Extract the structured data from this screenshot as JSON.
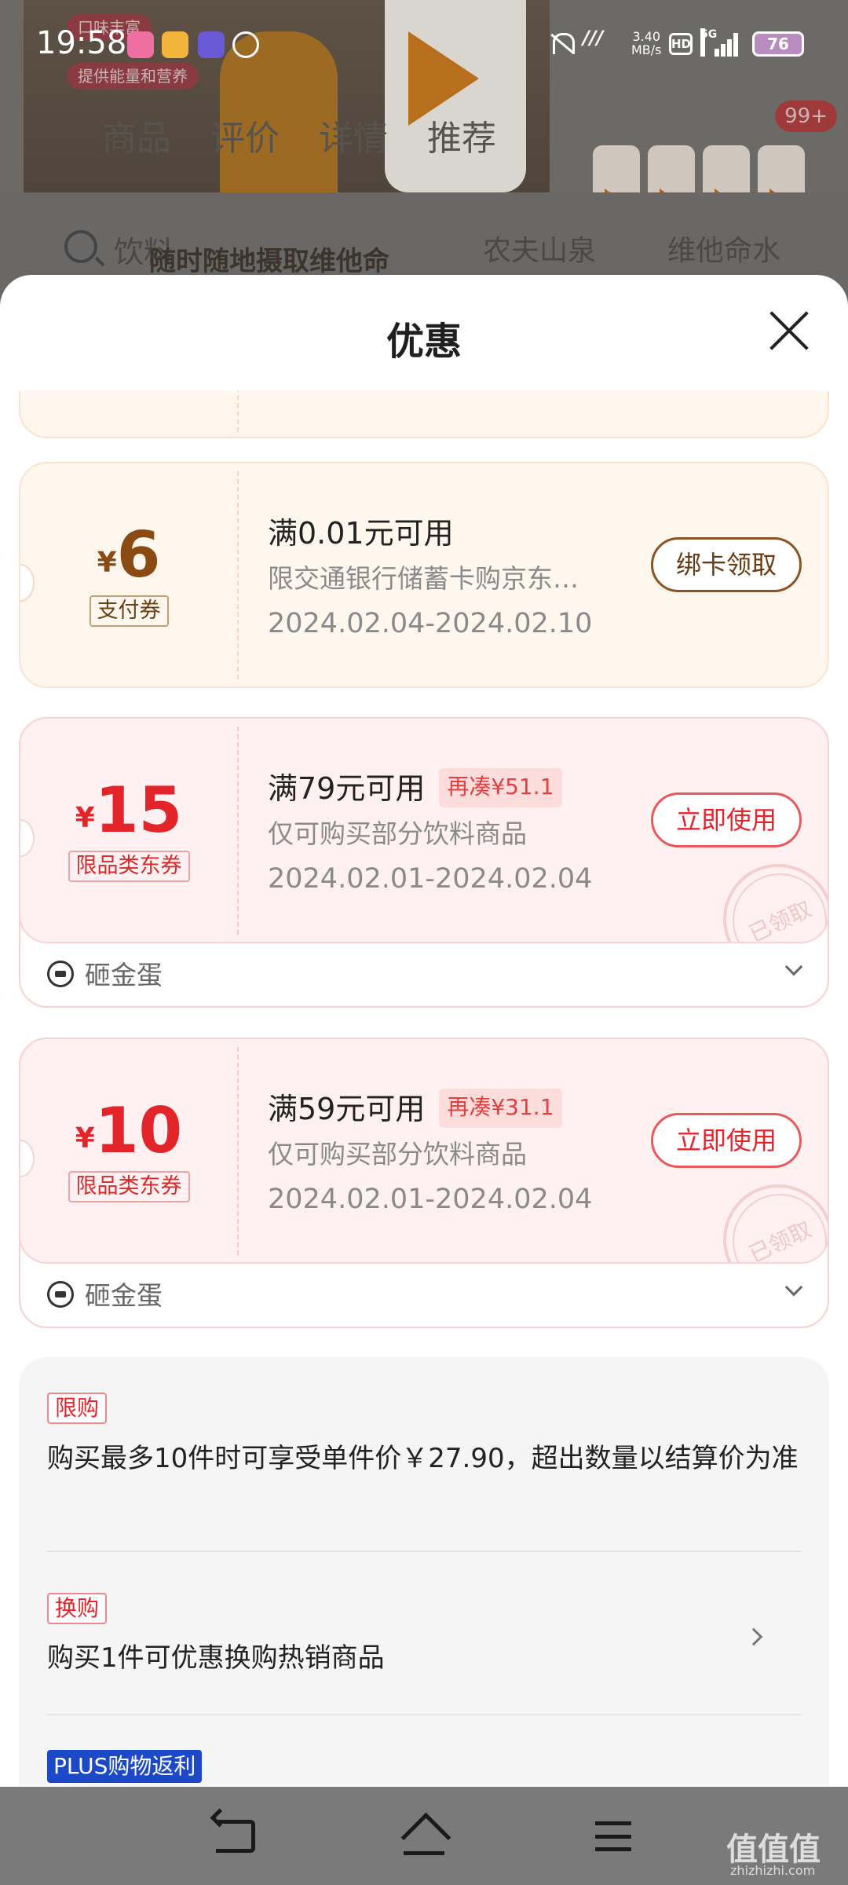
{
  "status_bar": {
    "time": "19:58",
    "net_speed_top": "3.40",
    "net_speed_bottom": "MB/s",
    "hd": "HD",
    "network": "5G",
    "battery": "76"
  },
  "background_page": {
    "badges": [
      "口味丰富",
      "提供能量和营养"
    ],
    "slogan": "随时随地摄取维他命",
    "tabs": [
      "商品",
      "评价",
      "详情",
      "推荐"
    ],
    "cart_badge": "99+",
    "search_placeholder": "饮料",
    "search_keywords": [
      "农夫山泉",
      "维他命水"
    ]
  },
  "sheet": {
    "title": "优惠"
  },
  "coupons": [
    {
      "currency": "¥",
      "amount": "6",
      "type_tag": "支付券",
      "condition": "满0.01元可用",
      "extra": "",
      "description": "限交通银行储蓄卡购京东…",
      "date_range": "2024.02.04-2024.02.10",
      "button": "绑卡领取"
    },
    {
      "currency": "¥",
      "amount": "15",
      "type_tag": "限品类东券",
      "condition": "满79元可用",
      "extra": "再凑¥51.1",
      "description": "仅可购买部分饮料商品",
      "date_range": "2024.02.01-2024.02.04",
      "button": "立即使用",
      "stamp": "已领取",
      "footer": "砸金蛋"
    },
    {
      "currency": "¥",
      "amount": "10",
      "type_tag": "限品类东券",
      "condition": "满59元可用",
      "extra": "再凑¥31.1",
      "description": "仅可购买部分饮料商品",
      "date_range": "2024.02.01-2024.02.04",
      "button": "立即使用",
      "stamp": "已领取",
      "footer": "砸金蛋"
    }
  ],
  "promotions": [
    {
      "tag": "限购",
      "text": "购买最多10件时可享受单件价￥27.90，超出数量以结算价为准"
    },
    {
      "tag": "换购",
      "text": "购买1件可优惠换购热销商品"
    },
    {
      "tag": "PLUS购物返利",
      "text": ""
    }
  ],
  "watermark": {
    "main": "值值值",
    "sub": "zhizhizhi.com"
  },
  "colors": {
    "coupon_orange": "#8b4a12",
    "coupon_red": "#e3242b",
    "plus_blue": "#1c49c8"
  }
}
